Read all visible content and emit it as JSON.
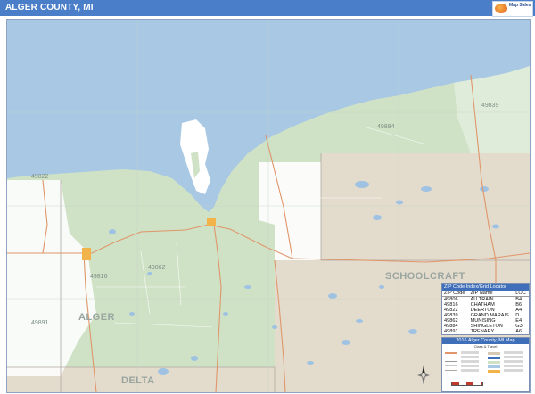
{
  "title": "ALGER COUNTY, MI",
  "logo": {
    "text": "Map Sales"
  },
  "colors": {
    "header": "#4a7ec8",
    "water": "#a8c8e4",
    "forest": "#cfe2c6",
    "private_land": "#e3dccd",
    "roads": "#e0956a",
    "town": "#f2b34a"
  },
  "map_labels": {
    "schoolcraft": "SCHOOLCRAFT",
    "alger": "ALGER",
    "delta": "DELTA"
  },
  "zip_labels": [
    {
      "code": "49839"
    },
    {
      "code": "49884"
    },
    {
      "code": "49822"
    },
    {
      "code": "49862"
    },
    {
      "code": "49816"
    },
    {
      "code": "49891"
    }
  ],
  "zip_index": {
    "title": "ZIP Code Index/Grid Locator",
    "columns": [
      "ZIP Code",
      "ZIP Name",
      "LOC"
    ],
    "rows": [
      [
        "49806",
        "AU TRAIN",
        "B4"
      ],
      [
        "49816",
        "CHATHAM",
        "B6"
      ],
      [
        "49822",
        "DEERTON",
        "A4"
      ],
      [
        "49839",
        "GRAND MARAIS",
        "D"
      ],
      [
        "49862",
        "MUNISING",
        "E4"
      ],
      [
        "49884",
        "SHINGLETON",
        "G3"
      ],
      [
        "49891",
        "TRENARY",
        "A6"
      ]
    ]
  },
  "legend": {
    "title": "2016 Alger County, MI Map",
    "subtitle": "Class & Travel"
  }
}
